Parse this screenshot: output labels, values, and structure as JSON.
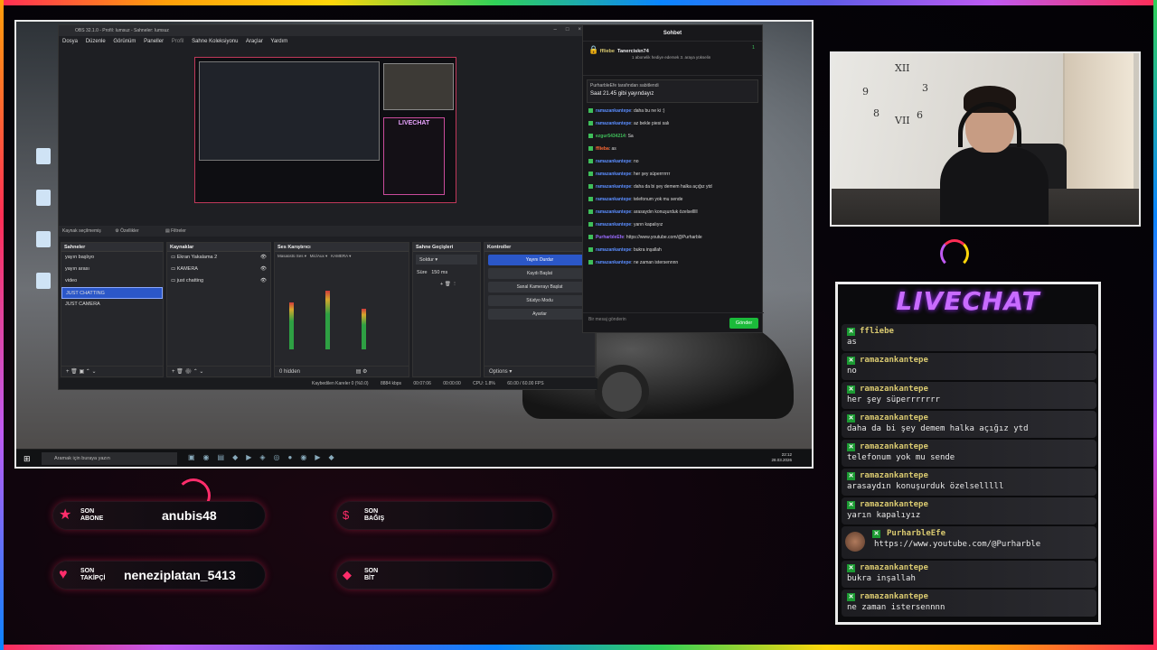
{
  "obs": {
    "title": "OBS 32.1.0 - Profil: Iumsuz - Sahneler: Iumsuz",
    "menu": [
      "Dosya",
      "Düzenle",
      "Görünüm",
      "Paneller",
      "Profil",
      "Sahne Koleksiyonu",
      "Araçlar",
      "Yardım"
    ],
    "toolbar": {
      "no_source": "Kaynak seçilmemiş",
      "properties": "Özellikler",
      "filters": "Filtreler"
    },
    "scenes": {
      "title": "Sahneler",
      "items": [
        "yayın başlıyo",
        "yayın arası",
        "video",
        "JUST CHATTING",
        "JUST CAMERA"
      ],
      "selected_index": 3
    },
    "sources": {
      "title": "Kaynaklar",
      "items": [
        "Ekran Yakalama 2",
        "KAMERA",
        "just chatting"
      ]
    },
    "mixer": {
      "title": "Ses Karıştırıcı",
      "channels": [
        "Masaüstü Ses",
        "Mic/Aux",
        "KAMERA"
      ],
      "levels": [
        0.58,
        0.72,
        0.5
      ],
      "hidden_label": "0 hidden"
    },
    "transitions": {
      "title": "Sahne Geçişleri",
      "type": "Soldur",
      "duration_label": "Süre",
      "duration": "150 ms"
    },
    "controls": {
      "title": "Kontroller",
      "buttons": [
        "Yayını Durdur",
        "Kaydı Başlat",
        "Sanal Kamerayı Başlat",
        "Stüdyo Modu",
        "Ayarlar"
      ]
    },
    "options_label": "Options",
    "status": {
      "dropped": "Kaybedilen Kareler 0 (%0.0)",
      "bitrate": "8884 kbps",
      "time": "00:07:06",
      "rec": "00:00:00",
      "cpu": "CPU: 1.8%",
      "fps": "60.00 / 60.00 FPS"
    }
  },
  "popout_chat": {
    "title": "Sohbet",
    "hype_user": "ffliebe",
    "gifter": "Tanercisk​n74",
    "gift_text": "1 abonelik hediye edersek 3. araya yükselin",
    "gift_count": "1",
    "pinned_by": "PurharbleEfe tarafından sabitlendi",
    "pinned_text": "Saat 21.45 gibi yayındayız",
    "messages": [
      {
        "user": "ramazankantepe",
        "text": "daha bu ne ki :)"
      },
      {
        "user": "ramazankantepe",
        "text": "az bekle piesi salı"
      },
      {
        "user": "ezgur5434214",
        "text": "Sa"
      },
      {
        "user": "fflieba",
        "text": "as"
      },
      {
        "user": "ramazankantepe",
        "text": "no"
      },
      {
        "user": "ramazankantepe",
        "text": "her şey süperrrrrrr"
      },
      {
        "user": "ramazankantepe",
        "text": "daha da bi şey demem halka açığız ytd"
      },
      {
        "user": "ramazankantepe",
        "text": "telefonum yok mu sende"
      },
      {
        "user": "ramazankantepe",
        "text": "arasaydın konuşurduk özelselllll"
      },
      {
        "user": "ramazankantepe",
        "text": "yarın kapalıyız"
      },
      {
        "user": "PurharbleEfe",
        "text": "https://www.youtube.com/@Purharble"
      },
      {
        "user": "ramazankantepe",
        "text": "bukra inşallah"
      },
      {
        "user": "ramazankantepe",
        "text": "ne zaman istersennnn"
      }
    ],
    "input_placeholder": "Bir mesaj gönderin",
    "send_label": "Gönder"
  },
  "taskbar": {
    "search_placeholder": "Aramak için buraya yazın",
    "time": "22:12",
    "date": "28.03.2026"
  },
  "livechat": {
    "title": "LIVECHAT",
    "messages": [
      {
        "user": "ffliebe",
        "text": "as"
      },
      {
        "user": "ramazankantepe",
        "text": "no"
      },
      {
        "user": "ramazankantepe",
        "text": "her şey süperrrrrrr"
      },
      {
        "user": "ramazankantepe",
        "text": "daha da bi şey demem halka açığız ytd"
      },
      {
        "user": "ramazankantepe",
        "text": "telefonum yok mu sende"
      },
      {
        "user": "ramazankantepe",
        "text": "arasaydın konuşurduk özelselllll"
      },
      {
        "user": "ramazankantepe",
        "text": "yarın kapalıyız"
      },
      {
        "user": "PurharbleEfe",
        "text": "https://www.youtube.com/@Purharble"
      },
      {
        "user": "ramazankantepe",
        "text": "bukra inşallah"
      },
      {
        "user": "ramazankantepe",
        "text": "ne zaman istersennnn"
      }
    ]
  },
  "alerts": [
    {
      "label_1": "SON",
      "label_2": "ABONE",
      "value": "anubis48",
      "icon": "star-icon"
    },
    {
      "label_1": "SON",
      "label_2": "BAĞIŞ",
      "value": "",
      "icon": "dollar-icon"
    },
    {
      "label_1": "SON",
      "label_2": "TAKİPÇİ",
      "value": "neneziplatan_5413",
      "icon": "heart-icon"
    },
    {
      "label_1": "SON",
      "label_2": "BİT",
      "value": "",
      "icon": "diamond-icon"
    }
  ],
  "colors": {
    "accent": "#2b57c8",
    "chat_green": "#1bba3a",
    "alert_pink": "#ff2d6b",
    "livechat_title": "#c86bff"
  }
}
